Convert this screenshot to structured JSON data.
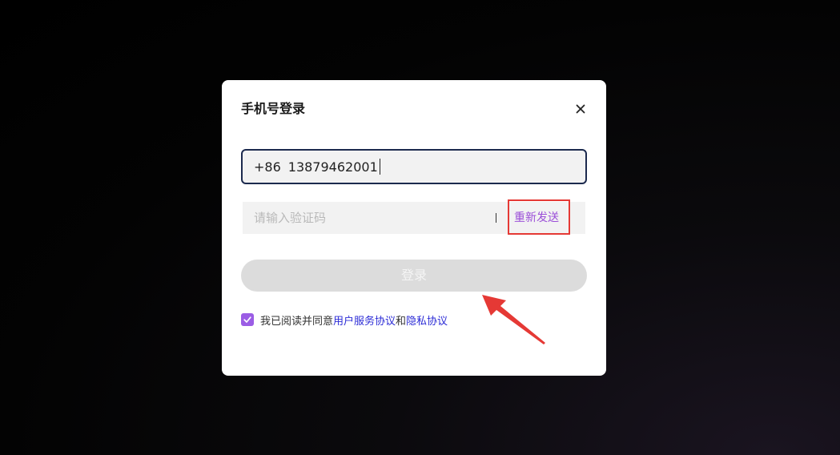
{
  "dialog": {
    "title": "手机号登录",
    "close_icon": "close-icon"
  },
  "phone": {
    "country_code": "+86",
    "value": "13879462001"
  },
  "verification": {
    "placeholder": "请输入验证码",
    "resend_label": "重新发送"
  },
  "login": {
    "label": "登录"
  },
  "agreement": {
    "checked": true,
    "prefix": "我已阅读并同意",
    "user_agreement": "用户服务协议",
    "conjunction": "和",
    "privacy_policy": "隐私协议"
  },
  "colors": {
    "accent": "#9b5de5",
    "link": "#2c2cd6",
    "annotation": "#e53935",
    "input_border": "#1c2a4e",
    "button_disabled": "#dcdcdc"
  }
}
